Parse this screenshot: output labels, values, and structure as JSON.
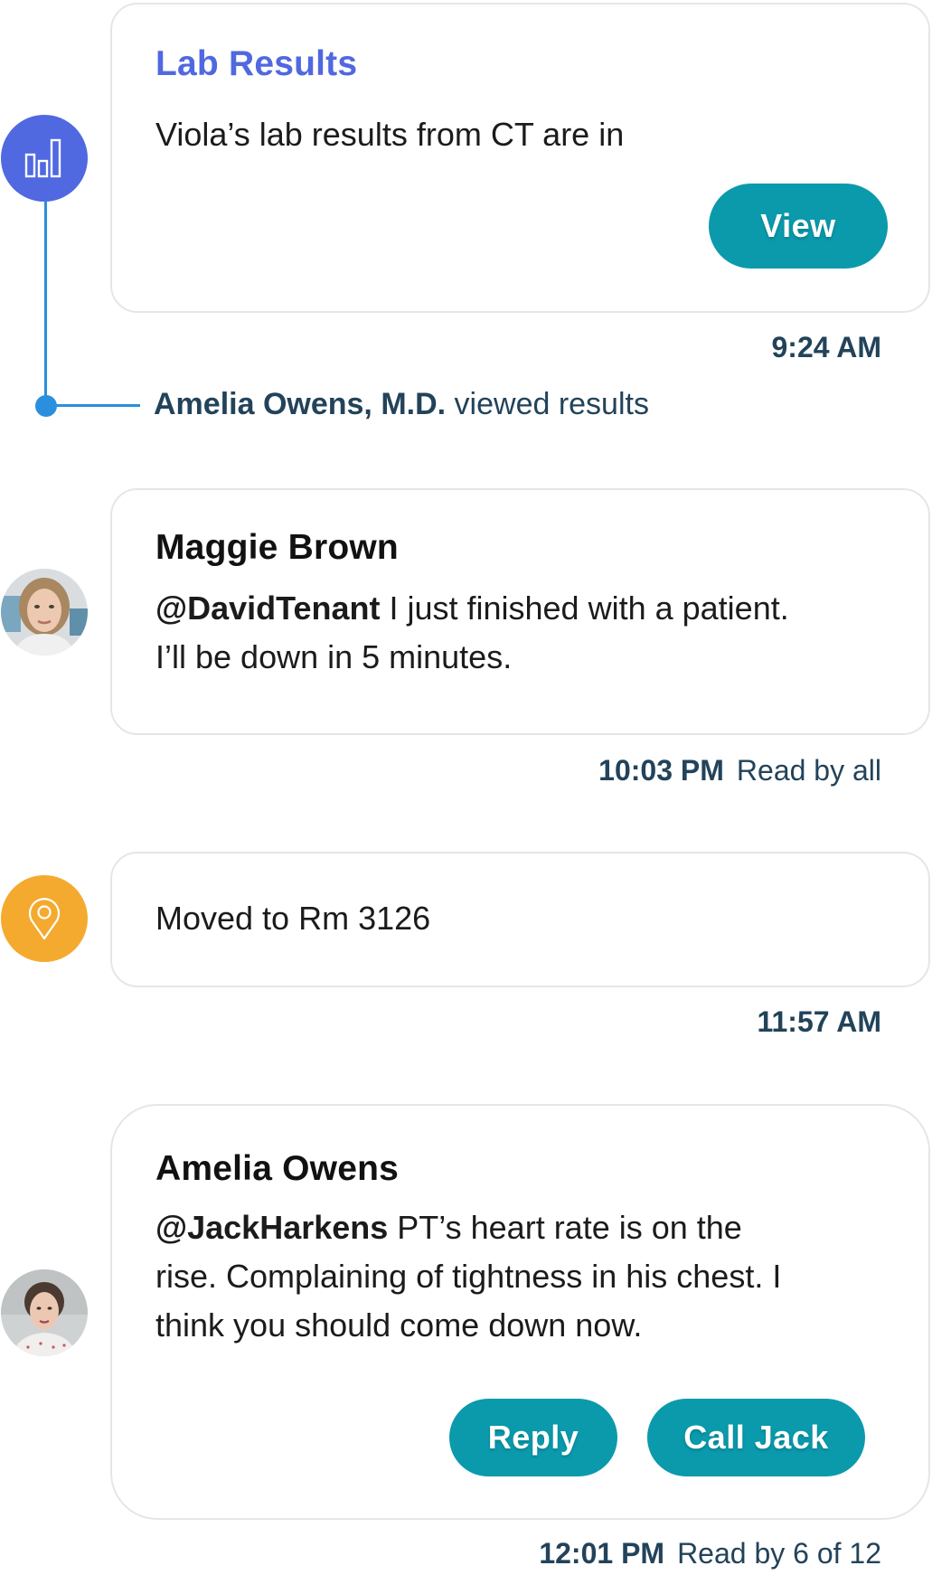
{
  "colors": {
    "lab_accent": "#5068E0",
    "button_teal": "#0A9AAC",
    "timeline_blue": "#2A8FDC",
    "location_orange": "#F4AA2E",
    "meta_text": "#22435A"
  },
  "feed": {
    "lab_results": {
      "icon": "bar-chart-icon",
      "title": "Lab Results",
      "body": "Viola’s lab results from CT are in",
      "button_label": "View",
      "time": "9:24 AM",
      "activity": {
        "who": "Amelia Owens, M.D.",
        "action": "viewed results"
      }
    },
    "message_maggie": {
      "avatar": "avatar-maggie-brown",
      "author": "Maggie Brown",
      "mention": "@DavidTenant",
      "body_line1": " I just finished with a patient.",
      "body_line2": "I’ll be down in 5 minutes.",
      "time": "10:03 PM",
      "read_status": "Read by all"
    },
    "location_update": {
      "icon": "location-pin-icon",
      "body": "Moved to Rm 3126",
      "time": "11:57 AM"
    },
    "message_amelia": {
      "avatar": "avatar-amelia-owens",
      "author": "Amelia Owens",
      "mention": "@JackHarkens",
      "body_line1": " PT’s heart rate is on the",
      "body_line2": "rise. Complaining of tightness in his chest. I",
      "body_line3": "think you should come down now.",
      "reply_label": "Reply",
      "call_label": "Call Jack",
      "time": "12:01 PM",
      "read_status": "Read by 6 of 12"
    }
  }
}
